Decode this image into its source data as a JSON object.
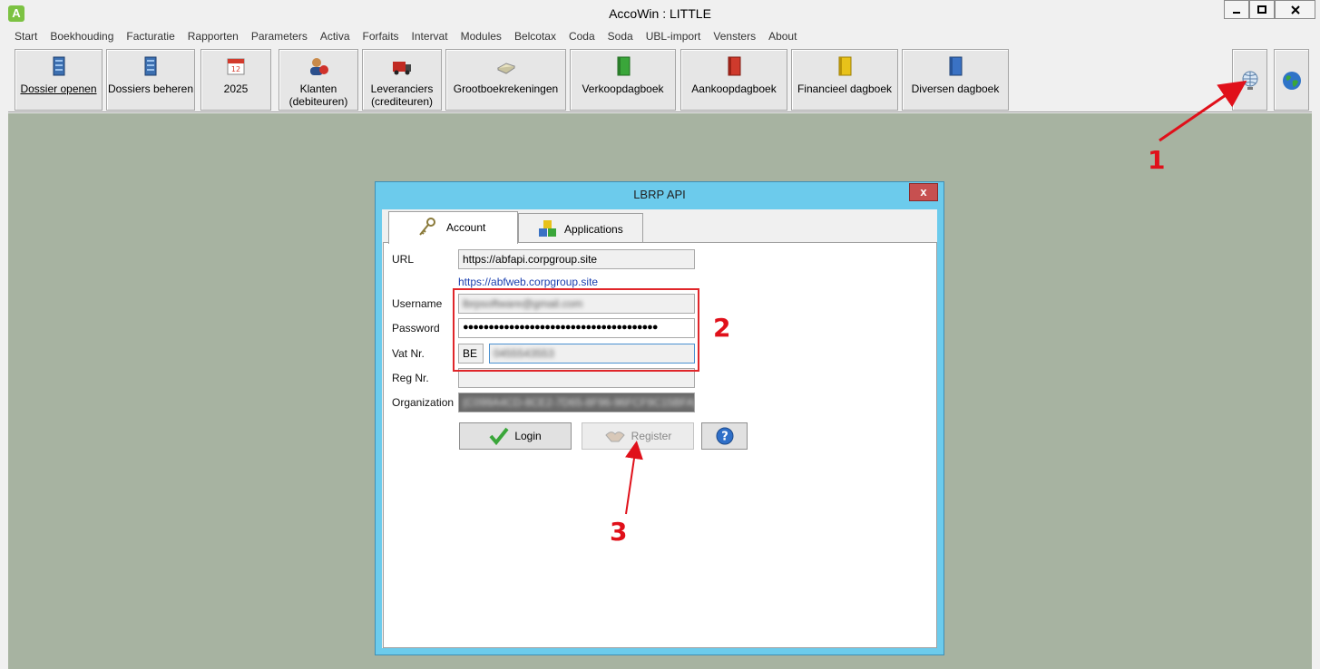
{
  "window": {
    "title": "AccoWin : LITTLE",
    "app_icon": "A"
  },
  "menu": [
    "Start",
    "Boekhouding",
    "Facturatie",
    "Rapporten",
    "Parameters",
    "Activa",
    "Forfaits",
    "Intervat",
    "Modules",
    "Belcotax",
    "Coda",
    "Soda",
    "UBL-import",
    "Vensters",
    "About"
  ],
  "toolbar": {
    "dossier_openen": "Dossier openen",
    "dossiers_beheren": "Dossiers beheren",
    "year": "2025",
    "klanten_1": "Klanten",
    "klanten_2": "(debiteuren)",
    "leveranciers_1": "Leveranciers",
    "leveranciers_2": "(crediteuren)",
    "grootboek": "Grootboekrekeningen",
    "verkoop": "Verkoopdagboek",
    "aankoop": "Aankoopdagboek",
    "financieel": "Financieel dagboek",
    "diversen": "Diversen dagboek"
  },
  "dialog": {
    "title": "LBRP API",
    "close": "x",
    "tabs": {
      "account": "Account",
      "applications": "Applications"
    },
    "labels": {
      "url": "URL",
      "username": "Username",
      "password": "Password",
      "vat": "Vat Nr.",
      "reg": "Reg Nr.",
      "organization": "Organization"
    },
    "values": {
      "url": "https://abfapi.corpgroup.site",
      "link": "https://abfweb.corpgroup.site",
      "username": "lbrpsoftware@gmail.com",
      "password": "●●●●●●●●●●●●●●●●●●●●●●●●●●●●●●●●●●●●●●",
      "vat_country": "BE",
      "vat_number": "0455543553",
      "reg": "",
      "organization": "{C099A4CD-8CE2-7D65-8F96-96FCF9C15BFA}"
    },
    "buttons": {
      "login": "Login",
      "register": "Register",
      "help": "?"
    }
  },
  "annotations": [
    "1",
    "2",
    "3"
  ],
  "colors": {
    "workspace": "#a7b3a1",
    "dialog_frame": "#6ccbec",
    "annotation": "#e0101a"
  }
}
